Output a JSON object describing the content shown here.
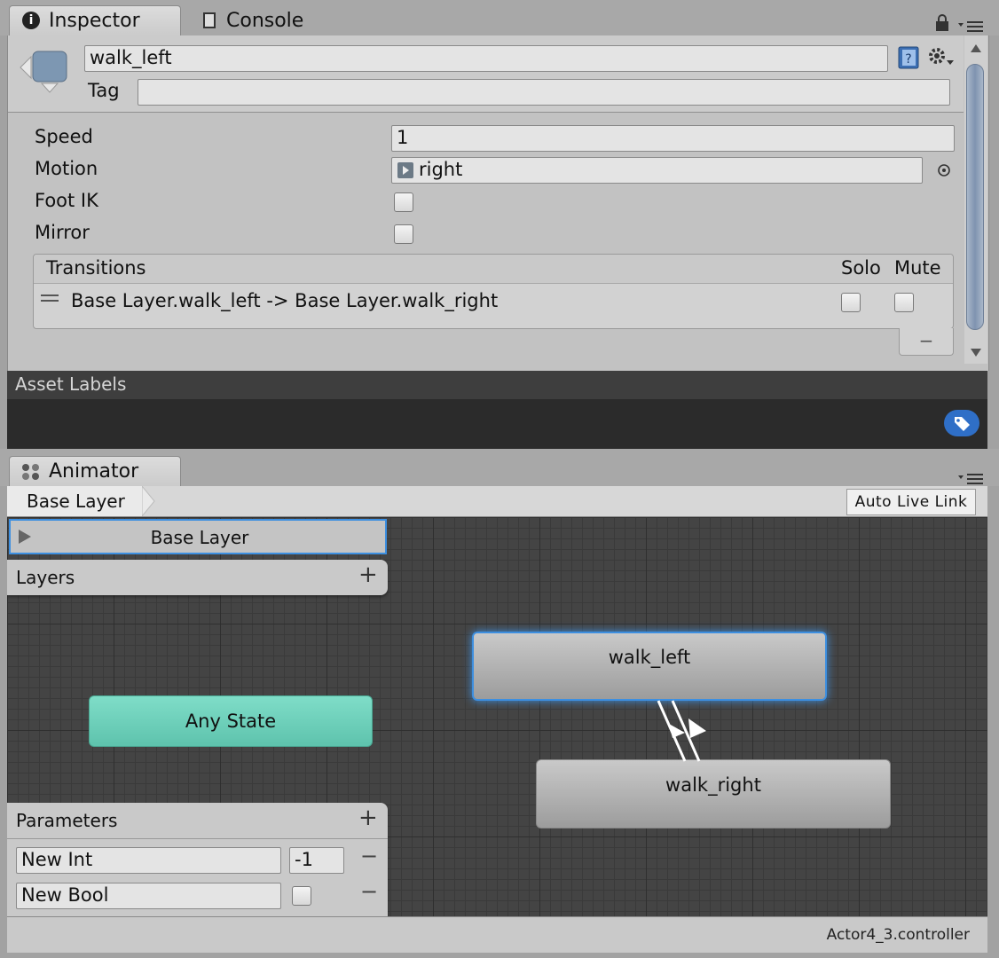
{
  "tabs": {
    "inspector": "Inspector",
    "console": "Console",
    "animator": "Animator"
  },
  "inspector": {
    "name_value": "walk_left",
    "tag_label": "Tag",
    "tag_value": "",
    "fields": [
      {
        "label": "Speed",
        "value": "1"
      },
      {
        "label": "Motion",
        "value": "right"
      },
      {
        "label": "Foot IK"
      },
      {
        "label": "Mirror"
      }
    ],
    "transitions": {
      "header": "Transitions",
      "solo": "Solo",
      "mute": "Mute",
      "rows": [
        {
          "text": "Base Layer.walk_left -> Base Layer.walk_right",
          "solo": false,
          "mute": false
        }
      ],
      "remove_label": "−"
    }
  },
  "asset_labels": {
    "title": "Asset Labels"
  },
  "animator": {
    "breadcrumb": "Base Layer",
    "auto_live_link": "Auto Live Link",
    "layer_name": "Base Layer",
    "layers_label": "Layers",
    "parameters_label": "Parameters",
    "add_label": "+",
    "remove_label": "−",
    "parameters": [
      {
        "name": "New Int",
        "value": "-1"
      },
      {
        "name": "New Bool",
        "value": false
      }
    ],
    "states": {
      "any_state": "Any State",
      "walk_left": "walk_left",
      "walk_right": "walk_right"
    },
    "footer": "Actor4_3.controller"
  },
  "colors": {
    "any_state": "#6dcdb8",
    "selection": "#3d8fe0",
    "asset_tag": "#2f6fc7"
  },
  "icons": [
    "info-icon",
    "console-icon",
    "lock-icon",
    "menu-icon",
    "back-arrow-icon",
    "help-book-icon",
    "gear-icon",
    "motion-clip-icon",
    "object-picker-icon",
    "tag-icon",
    "animator-icon",
    "play-triangle-icon"
  ]
}
